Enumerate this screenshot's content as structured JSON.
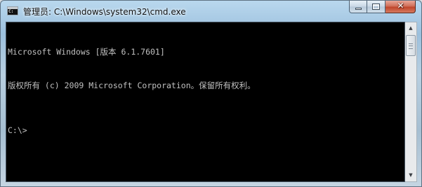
{
  "window": {
    "title": "管理员: C:\\Windows\\system32\\cmd.exe",
    "icon": "cmd-icon"
  },
  "caption_buttons": {
    "minimize": "minimize-icon",
    "maximize": "maximize-icon",
    "close_glyph": "✕"
  },
  "console": {
    "lines": [
      "Microsoft Windows [版本 6.1.7601]",
      "版权所有 (c) 2009 Microsoft Corporation。保留所有权利。"
    ],
    "prompt": "C:\\>",
    "background": "#000000",
    "foreground": "#c0c0c0"
  },
  "scrollbar": {
    "up_arrow": "▲",
    "down_arrow": "▼"
  }
}
